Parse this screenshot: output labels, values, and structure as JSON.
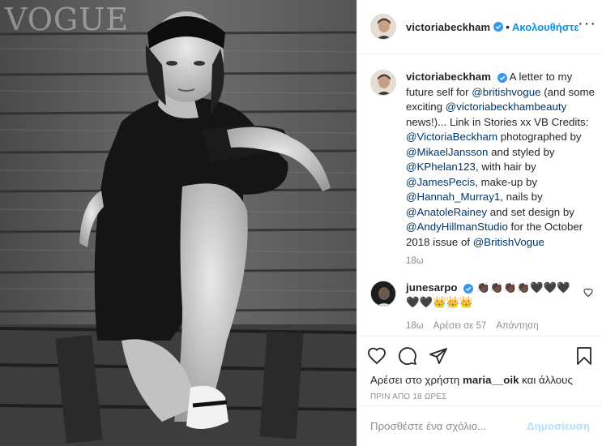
{
  "photo": {
    "magazine_logo": "VOGUE"
  },
  "header": {
    "username": "victoriabeckham",
    "separator": "•",
    "follow_label": "Ακολουθήστε",
    "more_icon": "more-horizontal-icon"
  },
  "caption": {
    "username": "victoriabeckham",
    "text_before": "A letter to my future self for ",
    "mention_british_vogue": "@britishvogue",
    "text_2": " (and some exciting ",
    "mention_vb_beauty": "@victoriabeckhambeauty",
    "text_3": " news!)... Link in Stories xx VB Credits: ",
    "mention_vb": "@VictoriaBeckham",
    "text_4": " photographed by ",
    "mention_mj": "@MikaelJansson",
    "text_5": " and styled by ",
    "mention_kp": "@KPhelan123",
    "text_6": ", with hair by ",
    "mention_jp": "@JamesPecis",
    "text_7": ", make-up by ",
    "mention_hm": "@Hannah_Murray1",
    "text_8": ", nails by ",
    "mention_ar": "@AnatoleRainey",
    "text_9": " and set design by ",
    "mention_ah": "@AndyHillmanStudio",
    "text_10": " for the October 2018 issue of ",
    "mention_bv": "@BritishVogue",
    "time": "18ω"
  },
  "comment": {
    "username": "junesarpo",
    "emoji_text": "👏🏿👏🏿👏🏿👏🏿🖤🖤🖤🖤🖤👑👑👑",
    "time": "18ω",
    "likes": "Αρέσει σε 57",
    "reply": "Απάντηση"
  },
  "actions": {
    "like_icon": "heart-icon",
    "comment_icon": "comment-icon",
    "share_icon": "share-icon",
    "save_icon": "bookmark-icon",
    "likes_prefix": "Αρέσει στο χρήστη ",
    "likes_user": "maria__oik",
    "likes_suffix": " και άλλους",
    "timestamp": "ΠΡΙΝ ΑΠΟ 18 ΩΡΕΣ"
  },
  "add_comment": {
    "placeholder": "Προσθέστε ένα σχόλιο...",
    "post_label": "Δημοσίευση"
  },
  "colors": {
    "accent": "#0095f6",
    "verified": "#3897f0",
    "mention": "#00376b",
    "muted": "#8e8e8e",
    "post_disabled": "#b2dffc"
  }
}
